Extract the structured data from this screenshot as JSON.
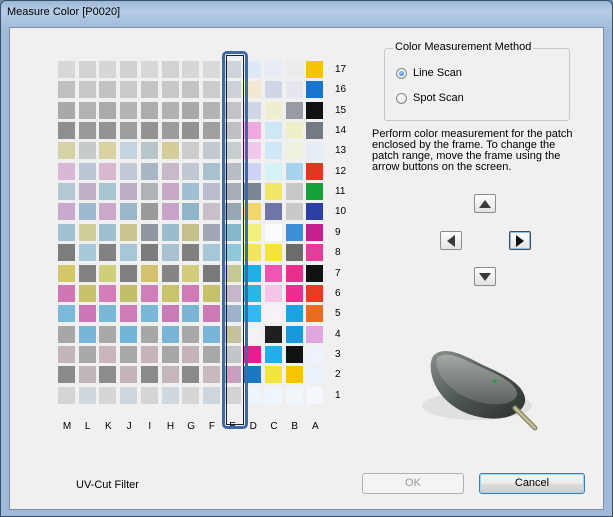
{
  "window": {
    "title": "Measure Color [P0020]"
  },
  "colors": {
    "frame": "#3e6aa3",
    "radio_selected": "#1f6fcf"
  },
  "chart": {
    "columns": [
      "M",
      "L",
      "K",
      "J",
      "I",
      "H",
      "G",
      "F",
      "E",
      "D",
      "C",
      "B",
      "A"
    ],
    "rows": [
      17,
      16,
      15,
      14,
      13,
      12,
      11,
      10,
      9,
      8,
      7,
      6,
      5,
      4,
      3,
      2,
      1
    ],
    "selected_column": "E",
    "patches": [
      [
        "#d8d8d8",
        "#d3d3d3",
        "#d6d6d6",
        "#d1d1d1",
        "#d8d8d8",
        "#d2d2d2",
        "#d6d6d6",
        "#dadada",
        "#cfd3da",
        "#dfe8f6",
        "#e8ecf4",
        "#ececef",
        "#f5c400"
      ],
      [
        "#bfbfbf",
        "#c8c8c8",
        "#c2c2c2",
        "#cacaca",
        "#c4c4c4",
        "#c8c8c8",
        "#c3c3c3",
        "#cccccc",
        "#cdd0d6",
        "#f3e8d0",
        "#cfd6e6",
        "#e6e6ef",
        "#1976cf"
      ],
      [
        "#a9a9a9",
        "#b2b2b2",
        "#aaaaaa",
        "#b4b4b4",
        "#acacac",
        "#b1b1b1",
        "#a9a9a9",
        "#b3b3b3",
        "#c2c3c7",
        "#cfd7e6",
        "#efefcf",
        "#989aa4",
        "#111111"
      ],
      [
        "#8f8f8f",
        "#9a9a9a",
        "#939393",
        "#9e9e9e",
        "#949494",
        "#9c9c9c",
        "#929292",
        "#a0a0a0",
        "#bfc0c4",
        "#f0a8e0",
        "#cfe6f5",
        "#efefc8",
        "#737a82"
      ],
      [
        "#d6d2a8",
        "#c7cbc8",
        "#d8d2a0",
        "#c5d3df",
        "#b8c6c9",
        "#d5cc9c",
        "#cccccc",
        "#c3c9d0",
        "#c6cfd0",
        "#f3c7ec",
        "#cfe7f7",
        "#ecf2dc",
        "#e6edf7"
      ],
      [
        "#d8b8d5",
        "#bcc5d5",
        "#d7b8cf",
        "#c2cad8",
        "#a9b7c4",
        "#c9b8c8",
        "#c1c8d3",
        "#a9c0cf",
        "#b7bdc5",
        "#d0d4f4",
        "#d4f3f7",
        "#a7d3ee",
        "#e5351f"
      ],
      [
        "#b3c7d4",
        "#c0b0c8",
        "#a9c5d4",
        "#bdb0c5",
        "#aeb3b6",
        "#c7a9c7",
        "#9fbfd2",
        "#b8bccd",
        "#a8aeb8",
        "#7d8697",
        "#f2e66a",
        "#c8c8c8",
        "#15a13a"
      ],
      [
        "#c9a9cd",
        "#9fb9d0",
        "#cba9cc",
        "#9bb6c8",
        "#9a9a9a",
        "#c7a3c7",
        "#8fb5c9",
        "#c8bfc9",
        "#96a9b3",
        "#f2d66a",
        "#6f76a7",
        "#c9c9c9",
        "#2c3fa4"
      ],
      [
        "#a1c2d3",
        "#cfcf9a",
        "#9fc0cf",
        "#c8c58f",
        "#8e97a0",
        "#9bbccb",
        "#c4c08a",
        "#9ea7b3",
        "#86b7cc",
        "#f0f07a",
        "#fbfbfb",
        "#3b8fd6",
        "#c91f8e"
      ],
      [
        "#7d7d7d",
        "#a8c7d8",
        "#828282",
        "#a7c7d6",
        "#7c7c7c",
        "#a8c2d2",
        "#808080",
        "#a6c7d6",
        "#8fc8d9",
        "#f4e55f",
        "#f3e33b",
        "#6c6c6c",
        "#e53c9a"
      ],
      [
        "#d4c76a",
        "#828282",
        "#cfcf7a",
        "#7f7f7f",
        "#d2c26d",
        "#858585",
        "#d0cc79",
        "#7a7a7a",
        "#c6c892",
        "#1fb0e8",
        "#ef56b4",
        "#ea2e8c",
        "#111111"
      ],
      [
        "#d076b4",
        "#c9c26a",
        "#d57db9",
        "#c4be6b",
        "#cf7fb7",
        "#c9c36b",
        "#d07ab6",
        "#c6c26c",
        "#c5b7c8",
        "#2bb6e6",
        "#f6c4e9",
        "#ea2f90",
        "#ea3a21"
      ],
      [
        "#7ab9d9",
        "#cf77b6",
        "#7ab8d7",
        "#cf7db6",
        "#7bb8d7",
        "#c97bb5",
        "#7ab6d4",
        "#cc7ab4",
        "#9eb3c9",
        "#32b9f3",
        "#f6f2f7",
        "#1ba3e3",
        "#ec6b20"
      ],
      [
        "#a7a7a7",
        "#78b5d6",
        "#a9a9a9",
        "#72b5d6",
        "#a7a7a7",
        "#7ab5d6",
        "#a9a9a9",
        "#78b5d6",
        "#c5c1a0",
        "#f2f2f2",
        "#1f1f1f",
        "#1897dd",
        "#dfa7df"
      ],
      [
        "#c3b6ba",
        "#a9a9a9",
        "#c9b6ba",
        "#a8a8a8",
        "#c6b4ba",
        "#a7a7a7",
        "#c5b3bc",
        "#a8a8a8",
        "#c3c6c8",
        "#e71e8e",
        "#1fb0ea",
        "#111111",
        "#eef3fb"
      ],
      [
        "#8a8a8a",
        "#c1b6b9",
        "#8c8c8c",
        "#c3b4b9",
        "#8a8a8a",
        "#c4b6bc",
        "#8a8a8a",
        "#c6b8bc",
        "#c5a1bf",
        "#1b78c3",
        "#f2e53d",
        "#f5c500",
        "#e9f2fb"
      ],
      [
        "#d5d5d5",
        "#cfd8de",
        "#d6d6d6",
        "#cfd7de",
        "#d5d5d5",
        "#cfd8de",
        "#d6d6d6",
        "#cdd6dd",
        "#d2d2d2",
        "#ecf5fc",
        "#eef6fc",
        "#f1f6fb",
        "#f4f8fc"
      ]
    ]
  },
  "method": {
    "group_title": "Color Measurement Method",
    "options": [
      {
        "label": "Line Scan",
        "selected": true
      },
      {
        "label": "Spot Scan",
        "selected": false
      }
    ]
  },
  "instructions": "Perform color measurement for the patch enclosed by the frame. To change the patch range, move the frame using the arrow buttons on the screen.",
  "footer": {
    "uv_label": "UV-Cut Filter",
    "ok_label": "OK",
    "cancel_label": "Cancel"
  }
}
